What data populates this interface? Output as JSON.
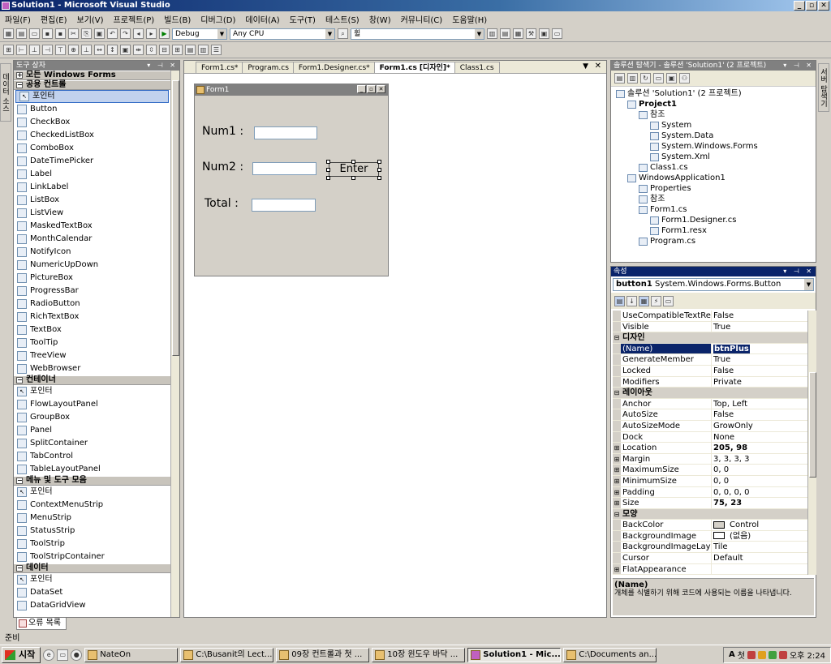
{
  "window": {
    "title": "Solution1 - Microsoft Visual Studio",
    "btn_min": "_",
    "btn_max": "▫",
    "btn_close": "✕"
  },
  "menu": [
    "파일(F)",
    "편집(E)",
    "보기(V)",
    "프로젝트(P)",
    "빌드(B)",
    "디버그(D)",
    "데이터(A)",
    "도구(T)",
    "테스트(S)",
    "창(W)",
    "커뮤니티(C)",
    "도움말(H)"
  ],
  "toolbar": {
    "config": "Debug",
    "platform": "Any CPU",
    "find": "휠"
  },
  "left_side_tab": "데이터 소스",
  "right_side_tab": "서버 탐색기",
  "toolbox": {
    "title": "도구 상자",
    "categories": [
      {
        "name": "모든 Windows Forms",
        "collapsed": true,
        "items": []
      },
      {
        "name": "공용 컨트롤",
        "items": [
          "포인터",
          "Button",
          "CheckBox",
          "CheckedListBox",
          "ComboBox",
          "DateTimePicker",
          "Label",
          "LinkLabel",
          "ListBox",
          "ListView",
          "MaskedTextBox",
          "MonthCalendar",
          "NotifyIcon",
          "NumericUpDown",
          "PictureBox",
          "ProgressBar",
          "RadioButton",
          "RichTextBox",
          "TextBox",
          "ToolTip",
          "TreeView",
          "WebBrowser"
        ]
      },
      {
        "name": "컨테이너",
        "items": [
          "포인터",
          "FlowLayoutPanel",
          "GroupBox",
          "Panel",
          "SplitContainer",
          "TabControl",
          "TableLayoutPanel"
        ]
      },
      {
        "name": "메뉴 및 도구 모음",
        "items": [
          "포인터",
          "ContextMenuStrip",
          "MenuStrip",
          "StatusStrip",
          "ToolStrip",
          "ToolStripContainer"
        ]
      },
      {
        "name": "데이터",
        "items": [
          "포인터",
          "DataSet",
          "DataGridView"
        ]
      }
    ],
    "bottom_tab": "오류 목록"
  },
  "doc_tabs": [
    "Form1.cs*",
    "Program.cs",
    "Form1.Designer.cs*",
    "Form1.cs [디자인]*",
    "Class1.cs"
  ],
  "form": {
    "title": "Form1",
    "num1_label": "Num1 :",
    "num2_label": "Num2 :",
    "total_label": "Total :",
    "enter_button": "Enter"
  },
  "solution_explorer": {
    "title": "솔루션 탐색기 - 솔루션 'Solution1' (2 프로젝트)",
    "nodes": [
      {
        "label": "솔루션 'Solution1' (2 프로젝트)",
        "level": 0
      },
      {
        "label": "Project1",
        "level": 1,
        "bold": true
      },
      {
        "label": "참조",
        "level": 2
      },
      {
        "label": "System",
        "level": 3
      },
      {
        "label": "System.Data",
        "level": 3
      },
      {
        "label": "System.Windows.Forms",
        "level": 3
      },
      {
        "label": "System.Xml",
        "level": 3
      },
      {
        "label": "Class1.cs",
        "level": 2
      },
      {
        "label": "WindowsApplication1",
        "level": 1
      },
      {
        "label": "Properties",
        "level": 2
      },
      {
        "label": "참조",
        "level": 2
      },
      {
        "label": "Form1.cs",
        "level": 2
      },
      {
        "label": "Form1.Designer.cs",
        "level": 3
      },
      {
        "label": "Form1.resx",
        "level": 3
      },
      {
        "label": "Program.cs",
        "level": 2
      }
    ]
  },
  "properties": {
    "title": "속성",
    "object": "button1",
    "object_type": "System.Windows.Forms.Button",
    "rows": [
      {
        "name": "UseCompatibleTextRendering",
        "value": "False"
      },
      {
        "name": "Visible",
        "value": "True"
      },
      {
        "cat": "디자인"
      },
      {
        "name": "(Name)",
        "value": "btnPlus",
        "selected": true
      },
      {
        "name": "GenerateMember",
        "value": "True"
      },
      {
        "name": "Locked",
        "value": "False"
      },
      {
        "name": "Modifiers",
        "value": "Private"
      },
      {
        "cat": "레이아웃"
      },
      {
        "name": "Anchor",
        "value": "Top, Left"
      },
      {
        "name": "AutoSize",
        "value": "False"
      },
      {
        "name": "AutoSizeMode",
        "value": "GrowOnly"
      },
      {
        "name": "Dock",
        "value": "None"
      },
      {
        "name": "Location",
        "value": "205, 98",
        "expand": true,
        "bold": true
      },
      {
        "name": "Margin",
        "value": "3, 3, 3, 3",
        "expand": true
      },
      {
        "name": "MaximumSize",
        "value": "0, 0",
        "expand": true
      },
      {
        "name": "MinimumSize",
        "value": "0, 0",
        "expand": true
      },
      {
        "name": "Padding",
        "value": "0, 0, 0, 0",
        "expand": true
      },
      {
        "name": "Size",
        "value": "75, 23",
        "expand": true,
        "bold": true
      },
      {
        "cat": "모양"
      },
      {
        "name": "BackColor",
        "value": "Control"
      },
      {
        "name": "BackgroundImage",
        "value": "(없음)"
      },
      {
        "name": "BackgroundImageLayout",
        "value": "Tile"
      },
      {
        "name": "Cursor",
        "value": "Default"
      },
      {
        "name": "FlatAppearance",
        "value": "",
        "expand": true
      }
    ],
    "desc_title": "(Name)",
    "desc_text": "개체를 식별하기 위해 코드에 사용되는 이름을 나타냅니다."
  },
  "status": "준비",
  "taskbar": {
    "start": "시작",
    "tasks": [
      "NateOn",
      "C:\\Busanit의 Lect...",
      "09장 컨트롤과 첫 ...",
      "10장 윈도우 바닥 ...",
      "Solution1 - Mic...",
      "C:\\Documents an..."
    ],
    "active_index": 4,
    "clock": "오후 2:24"
  }
}
